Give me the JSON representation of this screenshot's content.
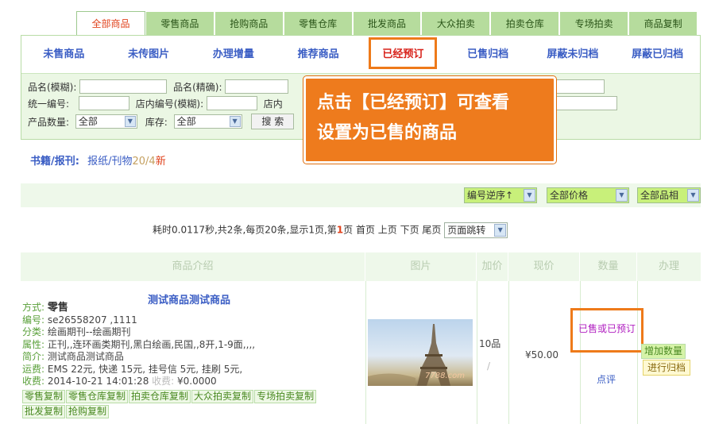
{
  "tabs": [
    "全部商品",
    "零售商品",
    "抢购商品",
    "零售仓库",
    "批发商品",
    "大众拍卖",
    "拍卖仓库",
    "专场拍卖",
    "商品复制"
  ],
  "subtabs": [
    "未售商品",
    "未传图片",
    "办理增量",
    "推荐商品",
    "已经预订",
    "已售归档",
    "屏蔽未归档",
    "屏蔽已归档"
  ],
  "search": {
    "name_fuzzy": "品名(模糊):",
    "name_exact": "品名(精确):",
    "serial": "统一编号:",
    "shop_serial": "店内编号(模糊):",
    "shop_trunc": "店内",
    "quantity": "产品数量:",
    "quantity_value": "全部",
    "stock": "库存:",
    "stock_value": "全部",
    "search_btn": "搜 索"
  },
  "callout": {
    "line1": "点击【已经预订】可查看",
    "line2": "设置为已售的商品"
  },
  "crumb": {
    "cat": "书籍/报刊",
    "sep": ":",
    "sub": "报纸/刊物",
    "count": "20/4",
    "new": "新"
  },
  "filters": {
    "sort": "编号逆序↑",
    "price": "全部价格",
    "grade": "全部品相"
  },
  "pager": {
    "pre": "耗时0.0117秒,共2条,每页20条,显示1页,第",
    "page": "1",
    "post": "页 首页 上页 下页  尾页",
    "jump": "页面跳转"
  },
  "table_headers": [
    "商品介绍",
    "图片",
    "加价",
    "现价",
    "数量",
    "办理"
  ],
  "item": {
    "title": "测试商品测试商品",
    "mode_label": "方式:",
    "mode": "零售",
    "id_label": "编号:",
    "id": "se26558207 ,1111",
    "cat_label": "分类:",
    "cat": "绘画期刊--绘画期刊",
    "attr_label": "属性:",
    "attr": "正刊,,连环画类期刊,黑白绘画,民国,,8开,1-9面,,,,",
    "brief_label": "简介:",
    "brief": "测试商品测试商品",
    "ship_label": "运费:",
    "ship": "EMS 22元, 快递 15元, 挂号信 5元, 挂刷 5元,",
    "recv_label": "收费:",
    "recv": "2014-10-21 14:01:28",
    "recv2_label": "收费:",
    "recv2": "¥0.0000",
    "tags1": [
      "零售复制",
      "零售仓库复制",
      "拍卖仓库复制",
      "大众拍卖复制",
      "专场拍卖复制"
    ],
    "tags2": [
      "批发复制",
      "抢购复制"
    ],
    "watermark": "7788.com",
    "add": "10品",
    "add_slash": "/",
    "price": "¥50.00",
    "sold": "已售或已预订",
    "review": "点评",
    "act_add": "增加数量",
    "act_archive": "进行归档"
  }
}
